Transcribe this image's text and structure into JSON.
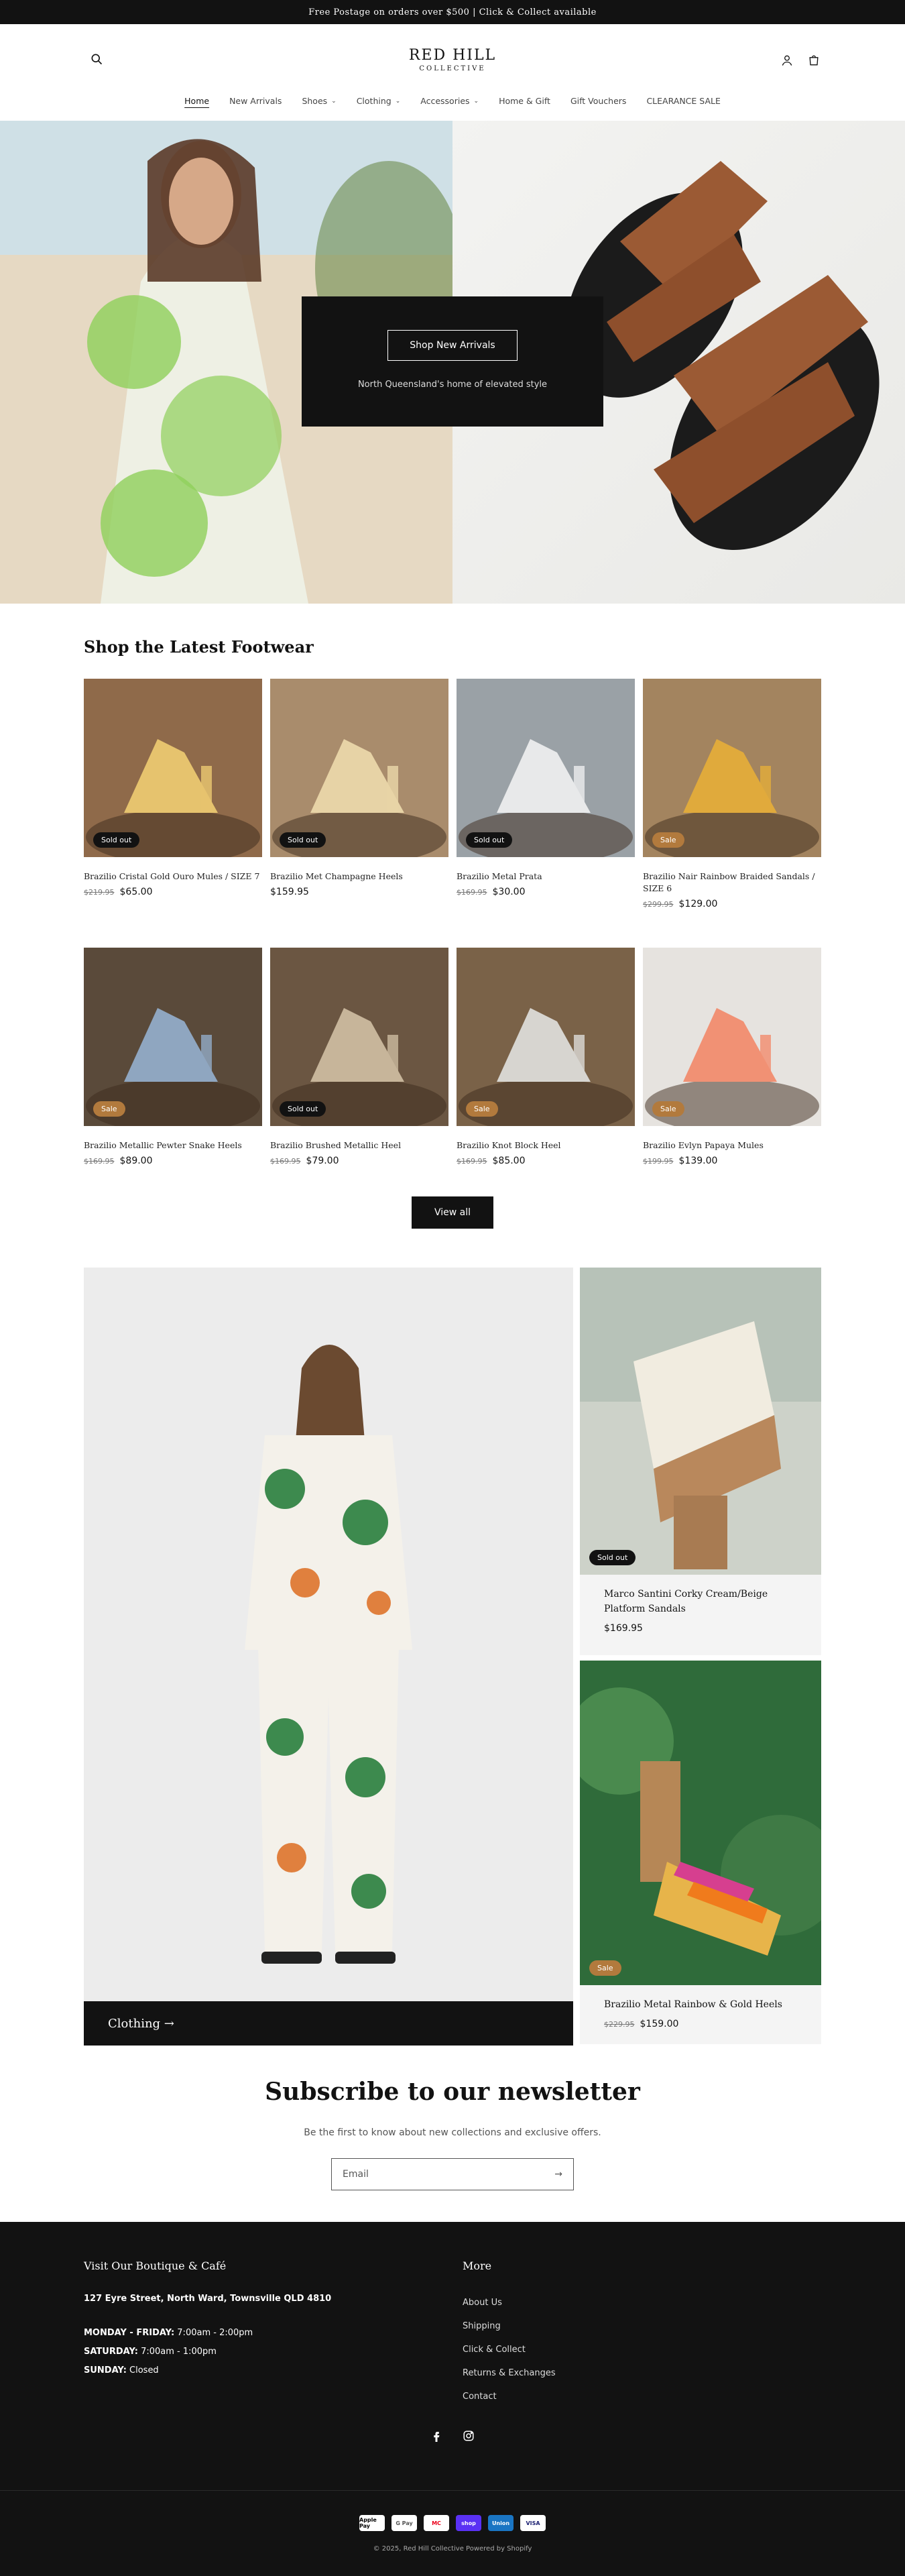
{
  "announcement": "Free Postage on orders over $500 | Click & Collect available",
  "logo": {
    "line1": "RED HILL",
    "line2": "COLLECTIVE"
  },
  "nav": [
    {
      "label": "Home",
      "active": true
    },
    {
      "label": "New Arrivals"
    },
    {
      "label": "Shoes",
      "dropdown": true
    },
    {
      "label": "Clothing",
      "dropdown": true
    },
    {
      "label": "Accessories",
      "dropdown": true
    },
    {
      "label": "Home & Gift"
    },
    {
      "label": "Gift Vouchers"
    },
    {
      "label": "CLEARANCE SALE"
    }
  ],
  "hero": {
    "button": "Shop New Arrivals",
    "subtitle": "North Queensland's home of elevated style"
  },
  "footwear": {
    "title": "Shop the Latest Footwear",
    "products": [
      {
        "title": "Brazilio Cristal Gold Ouro Mules / SIZE 7",
        "compare": "$219.95",
        "price": "$65.00",
        "badge": "Sold out",
        "badgeType": "sold"
      },
      {
        "title": "Brazilio Met Champagne Heels",
        "compare": "",
        "price": "$159.95",
        "badge": "Sold out",
        "badgeType": "sold"
      },
      {
        "title": "Brazilio Metal Prata",
        "compare": "$169.95",
        "price": "$30.00",
        "badge": "Sold out",
        "badgeType": "sold"
      },
      {
        "title": "Brazilio Nair Rainbow Braided Sandals / SIZE 6",
        "compare": "$299.95",
        "price": "$129.00",
        "badge": "Sale",
        "badgeType": "sale"
      },
      {
        "title": "Brazilio Metallic Pewter Snake Heels",
        "compare": "$169.95",
        "price": "$89.00",
        "badge": "Sale",
        "badgeType": "sale"
      },
      {
        "title": "Brazilio Brushed Metallic Heel",
        "compare": "$169.95",
        "price": "$79.00",
        "badge": "Sold out",
        "badgeType": "sold"
      },
      {
        "title": "Brazilio Knot Block Heel",
        "compare": "$169.95",
        "price": "$85.00",
        "badge": "Sale",
        "badgeType": "sale"
      },
      {
        "title": "Brazilio Evlyn Papaya Mules",
        "compare": "$199.95",
        "price": "$139.00",
        "badge": "Sale",
        "badgeType": "sale"
      }
    ],
    "view_all": "View all"
  },
  "collection": {
    "label": "Clothing →"
  },
  "featured": [
    {
      "title": "Marco Santini Corky Cream/Beige Platform Sandals",
      "compare": "",
      "price": "$169.95",
      "badge": "Sold out"
    },
    {
      "title": "Brazilio Metal Rainbow & Gold Heels",
      "compare": "$229.95",
      "price": "$159.00",
      "badge": "Sale"
    }
  ],
  "newsletter": {
    "title": "Subscribe to our newsletter",
    "subtitle": "Be the first to know about new collections and exclusive offers.",
    "placeholder": "Email"
  },
  "footer": {
    "visit_title": "Visit Our Boutique & Café",
    "address": "127 Eyre Street, North Ward, Townsville QLD 4810",
    "hours": [
      {
        "day": "MONDAY - FRIDAY:",
        "time": " 7:00am - 2:00pm"
      },
      {
        "day": "SATURDAY:",
        "time": " 7:00am - 1:00pm"
      },
      {
        "day": "SUNDAY:",
        "time": " Closed"
      }
    ],
    "more_title": "More",
    "links": [
      "About Us",
      "Shipping",
      "Click & Collect",
      "Returns & Exchanges",
      "Contact"
    ],
    "payments": [
      "Apple Pay",
      "G Pay",
      "MC",
      "shop",
      "Union",
      "VISA"
    ],
    "copyright": "© 2025, Red Hill Collective Powered by Shopify"
  },
  "colors": {
    "dark": "#121212",
    "sale_badge": "#b27a3d"
  }
}
